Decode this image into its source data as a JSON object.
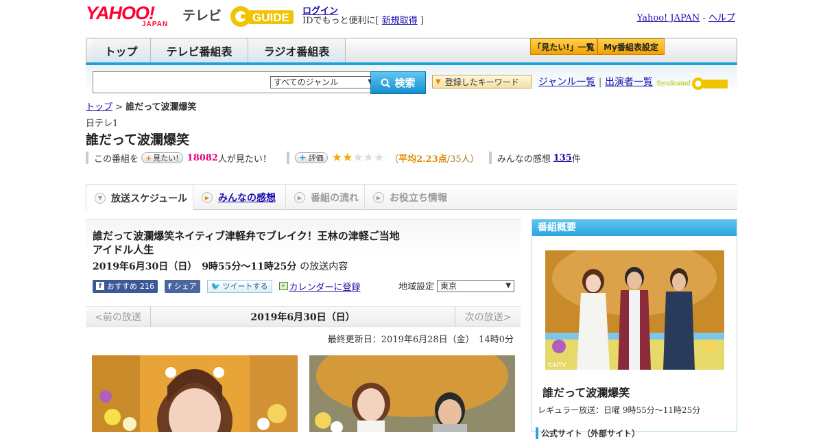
{
  "header": {
    "logo_main": "YAHOO!",
    "logo_sub": "JAPAN",
    "service_label": "テレビ",
    "gguide_logo": "GUIDE",
    "login_link": "ログイン",
    "id_text": "IDでもっと便利に[ ",
    "register_link": "新規取得",
    "id_text_end": " ]",
    "yahoo_japan_link": "Yahoo! JAPAN",
    "dash": " - ",
    "help_link": "ヘルプ"
  },
  "nav": {
    "tabs": [
      {
        "label": "トップ"
      },
      {
        "label": "テレビ番組表"
      },
      {
        "label": "ラジオ番組表"
      }
    ],
    "mitai_button": "「見たい!」一覧",
    "my_schedule_button": "My番組表設定"
  },
  "search": {
    "genre_select": "すべてのジャンル",
    "search_button": "検索",
    "keyword_button": "登録したキーワード",
    "genre_list_link": "ジャンル一覧",
    "separator": "|",
    "performer_link": "出演者一覧",
    "syndicated": "Syndicated"
  },
  "breadcrumb": {
    "home": "トップ",
    "sep": " > ",
    "current": "誰だって波瀾爆笑"
  },
  "program": {
    "channel": "日テレ1",
    "title": "誰だって波瀾爆笑",
    "stats": {
      "prefix": "この番組を",
      "mitai_btn": "見たい!",
      "mitai_count": "18082",
      "mitai_suffix": "人が見たい！",
      "rate_btn": "評価",
      "rating_stars": 2,
      "rating_open": "（",
      "rating_avg": "平均2.23点",
      "rating_people": "/35人）",
      "kansou_label": "みんなの感想",
      "kansou_count": "135",
      "kansou_suffix": "件"
    }
  },
  "subtabs": [
    {
      "label": "放送スケジュール"
    },
    {
      "label": "みんなの感想"
    },
    {
      "label": "番組の流れ"
    },
    {
      "label": "お役立ち情報"
    }
  ],
  "episode": {
    "title": "誰だって波瀾爆笑ネイティブ津軽弁でブレイク！王林の津軽ご当地アイドル人生",
    "date_time": "2019年6月30日（日）　9時55分～11時25分",
    "date_suffix": "の放送内容",
    "fb_recommend": "おすすめ",
    "fb_count": "216",
    "fb_share": "シェア",
    "tweet": "ツイートする",
    "calendar": "カレンダーに登録",
    "region_label": "地域設定",
    "region_value": "東京",
    "prev": "<前の放送",
    "current_date": "2019年6月30日（日）",
    "next": "次の放送>",
    "updated": "最終更新日：2019年6月28日（金）　14時0分"
  },
  "sidebar": {
    "heading": "番組概要",
    "copyright": "©NTV",
    "title": "誰だって波瀾爆笑",
    "schedule": "レギュラー放送：日曜 9時55分～11時25分",
    "official_site": "公式サイト（外部サイト）"
  },
  "colors": {
    "accent_blue": "#1aa0dc",
    "yahoo_red": "#ff0033",
    "pink": "#e5007f",
    "star": "#f2a900"
  }
}
